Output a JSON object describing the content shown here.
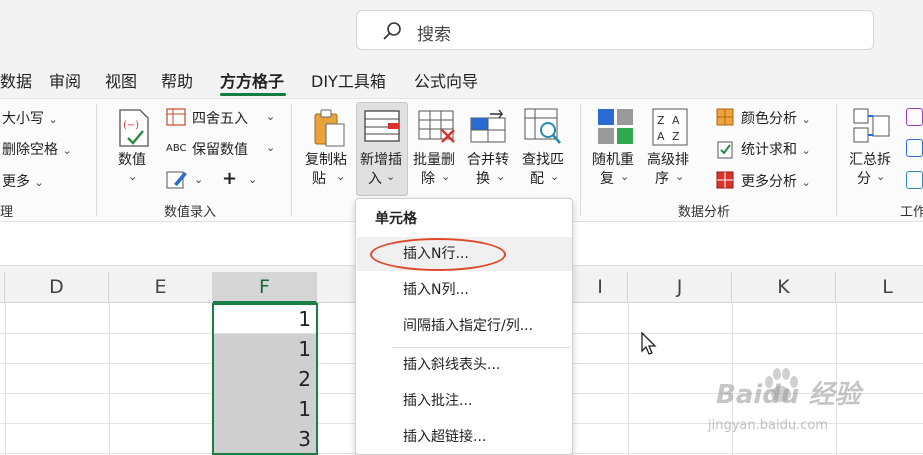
{
  "search": {
    "label": "搜索"
  },
  "tabs": [
    {
      "label": "数据"
    },
    {
      "label": "审阅"
    },
    {
      "label": "视图"
    },
    {
      "label": "帮助"
    },
    {
      "label": "方方格子"
    },
    {
      "label": "DIY工具箱"
    },
    {
      "label": "公式向导"
    }
  ],
  "ribbon": {
    "left_group": {
      "items": [
        "大小写",
        "删除空格",
        "更多"
      ],
      "label": "理"
    },
    "numeric_group": {
      "label": "数值录入",
      "big_button": "数值",
      "items": [
        "四舍五入",
        "保留数值"
      ],
      "plus": "+"
    },
    "paste_button": [
      "复制粘",
      "贴"
    ],
    "insert_button": [
      "新增插",
      "入"
    ],
    "batch_delete_button": [
      "批量删",
      "除"
    ],
    "merge_convert_button": [
      "合并转",
      "换"
    ],
    "find_match_button": [
      "查找匹",
      "配"
    ],
    "analysis_group": {
      "label": "数据分析",
      "random_button": [
        "随机重",
        "复"
      ],
      "sort_button": [
        "高级排",
        "序"
      ],
      "items": [
        "颜色分析",
        "统计求和",
        "更多分析"
      ]
    },
    "summary_button": [
      "汇总拆",
      "分"
    ],
    "work_group_label": "工作"
  },
  "grid": {
    "columns": [
      "D",
      "E",
      "F",
      "I",
      "J",
      "K",
      "L"
    ],
    "f_values": [
      "1",
      "1",
      "2",
      "1",
      "3"
    ]
  },
  "dropdown": {
    "header": "单元格",
    "items": [
      "插入N行...",
      "插入N列...",
      "间隔插入指定行/列...",
      "插入斜线表头...",
      "插入批注...",
      "插入超链接..."
    ]
  },
  "watermark": {
    "main": "Baidu 经验",
    "sub": "jingyan.baidu.com"
  },
  "colors": {
    "accent": "#107c41",
    "selection": "#1a7f45",
    "highlight": "#e0482a"
  }
}
